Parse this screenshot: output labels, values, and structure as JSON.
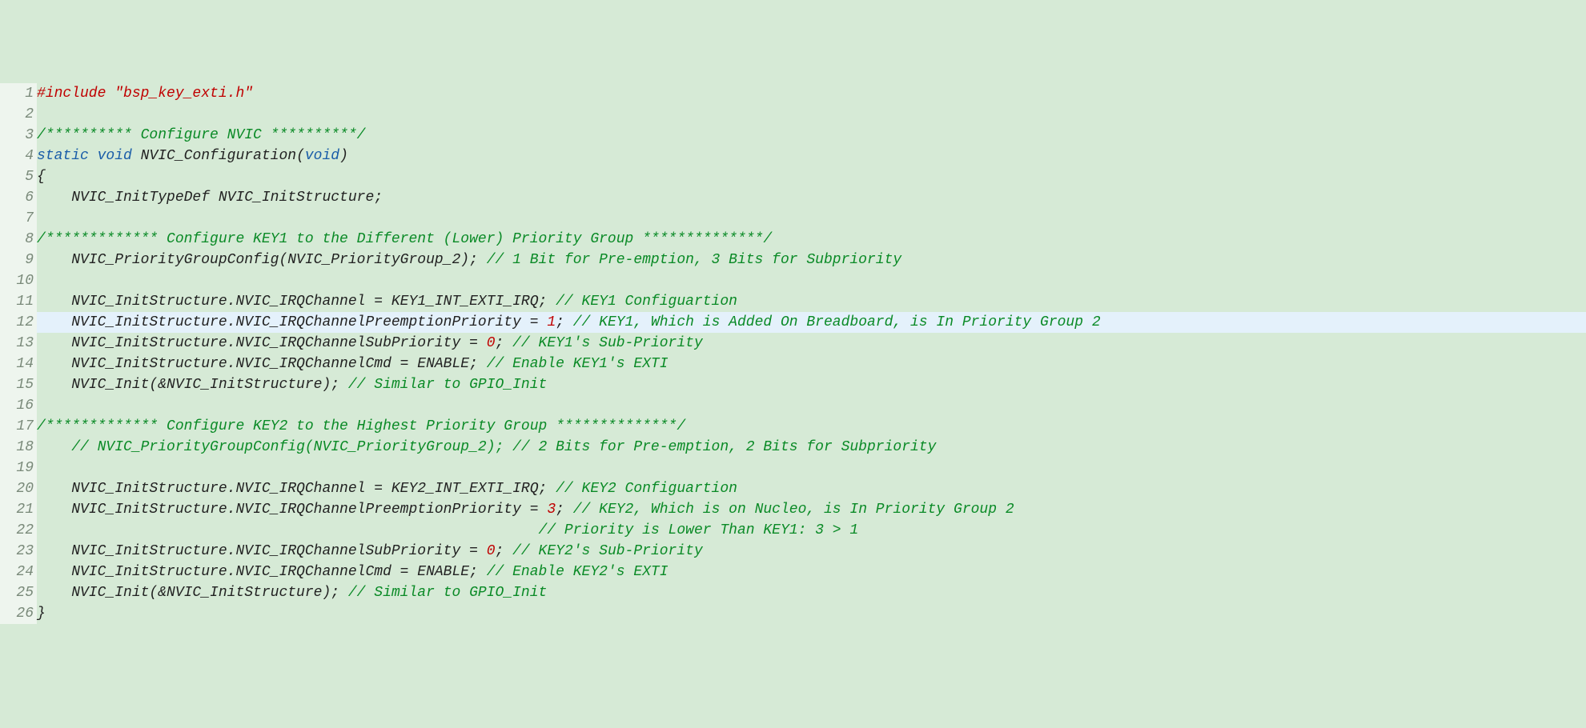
{
  "editor": {
    "highlighted_line": 12,
    "lines": {
      "1": {
        "tokens": [
          {
            "cls": "c-pre",
            "t": "#include "
          },
          {
            "cls": "c-str",
            "t": "\"bsp_key_exti.h\""
          }
        ]
      },
      "2": {
        "tokens": [
          {
            "cls": "c-id",
            "t": ""
          }
        ]
      },
      "3": {
        "tokens": [
          {
            "cls": "c-cmt",
            "t": "/********** Configure NVIC **********/"
          }
        ]
      },
      "4": {
        "tokens": [
          {
            "cls": "c-kw",
            "t": "static "
          },
          {
            "cls": "c-kw",
            "t": "void "
          },
          {
            "cls": "c-id",
            "t": "NVIC_Configuration("
          },
          {
            "cls": "c-kw",
            "t": "void"
          },
          {
            "cls": "c-id",
            "t": ")"
          }
        ]
      },
      "5": {
        "tokens": [
          {
            "cls": "c-id",
            "t": "{"
          }
        ]
      },
      "6": {
        "tokens": [
          {
            "cls": "c-id",
            "t": "    NVIC_InitTypeDef NVIC_InitStructure;"
          }
        ]
      },
      "7": {
        "tokens": [
          {
            "cls": "c-id",
            "t": ""
          }
        ]
      },
      "8": {
        "tokens": [
          {
            "cls": "c-cmt",
            "t": "/************* Configure KEY1 to the Different (Lower) Priority Group **************/"
          }
        ]
      },
      "9": {
        "tokens": [
          {
            "cls": "c-id",
            "t": "    NVIC_PriorityGroupConfig(NVIC_PriorityGroup_2); "
          },
          {
            "cls": "c-cmt",
            "t": "// 1 Bit for Pre-emption, 3 Bits for Subpriority"
          }
        ]
      },
      "10": {
        "tokens": [
          {
            "cls": "c-id",
            "t": ""
          }
        ]
      },
      "11": {
        "tokens": [
          {
            "cls": "c-id",
            "t": "    NVIC_InitStructure.NVIC_IRQChannel = KEY1_INT_EXTI_IRQ; "
          },
          {
            "cls": "c-cmt",
            "t": "// KEY1 Configuartion"
          }
        ]
      },
      "12": {
        "tokens": [
          {
            "cls": "c-id",
            "t": "    NVIC_InitStructure.NVIC_IRQChannelPreemptionPriority = "
          },
          {
            "cls": "c-num",
            "t": "1"
          },
          {
            "cls": "c-id",
            "t": "; "
          },
          {
            "cls": "c-cmt",
            "t": "// KEY1, Which is Added On Breadboard, is In Priority Group 2"
          }
        ]
      },
      "13": {
        "tokens": [
          {
            "cls": "c-id",
            "t": "    NVIC_InitStructure.NVIC_IRQChannelSubPriority = "
          },
          {
            "cls": "c-num",
            "t": "0"
          },
          {
            "cls": "c-id",
            "t": "; "
          },
          {
            "cls": "c-cmt",
            "t": "// KEY1's Sub-Priority"
          }
        ]
      },
      "14": {
        "tokens": [
          {
            "cls": "c-id",
            "t": "    NVIC_InitStructure.NVIC_IRQChannelCmd = ENABLE; "
          },
          {
            "cls": "c-cmt",
            "t": "// Enable KEY1's EXTI"
          }
        ]
      },
      "15": {
        "tokens": [
          {
            "cls": "c-id",
            "t": "    NVIC_Init(&NVIC_InitStructure); "
          },
          {
            "cls": "c-cmt",
            "t": "// Similar to GPIO_Init"
          }
        ]
      },
      "16": {
        "tokens": [
          {
            "cls": "c-id",
            "t": ""
          }
        ]
      },
      "17": {
        "tokens": [
          {
            "cls": "c-cmt",
            "t": "/************* Configure KEY2 to the Highest Priority Group **************/"
          }
        ]
      },
      "18": {
        "tokens": [
          {
            "cls": "c-id",
            "t": "    "
          },
          {
            "cls": "c-cmt",
            "t": "// NVIC_PriorityGroupConfig(NVIC_PriorityGroup_2); // 2 Bits for Pre-emption, 2 Bits for Subpriority"
          }
        ]
      },
      "19": {
        "tokens": [
          {
            "cls": "c-id",
            "t": ""
          }
        ]
      },
      "20": {
        "tokens": [
          {
            "cls": "c-id",
            "t": "    NVIC_InitStructure.NVIC_IRQChannel = KEY2_INT_EXTI_IRQ; "
          },
          {
            "cls": "c-cmt",
            "t": "// KEY2 Configuartion"
          }
        ]
      },
      "21": {
        "tokens": [
          {
            "cls": "c-id",
            "t": "    NVIC_InitStructure.NVIC_IRQChannelPreemptionPriority = "
          },
          {
            "cls": "c-num",
            "t": "3"
          },
          {
            "cls": "c-id",
            "t": "; "
          },
          {
            "cls": "c-cmt",
            "t": "// KEY2, Which is on Nucleo, is In Priority Group 2"
          }
        ]
      },
      "22": {
        "tokens": [
          {
            "cls": "c-id",
            "t": "                                                          "
          },
          {
            "cls": "c-cmt",
            "t": "// Priority is Lower Than KEY1: 3 > 1"
          }
        ]
      },
      "23": {
        "tokens": [
          {
            "cls": "c-id",
            "t": "    NVIC_InitStructure.NVIC_IRQChannelSubPriority = "
          },
          {
            "cls": "c-num",
            "t": "0"
          },
          {
            "cls": "c-id",
            "t": "; "
          },
          {
            "cls": "c-cmt",
            "t": "// KEY2's Sub-Priority"
          }
        ]
      },
      "24": {
        "tokens": [
          {
            "cls": "c-id",
            "t": "    NVIC_InitStructure.NVIC_IRQChannelCmd = ENABLE; "
          },
          {
            "cls": "c-cmt",
            "t": "// Enable KEY2's EXTI"
          }
        ]
      },
      "25": {
        "tokens": [
          {
            "cls": "c-id",
            "t": "    NVIC_Init(&NVIC_InitStructure); "
          },
          {
            "cls": "c-cmt",
            "t": "// Similar to GPIO_Init"
          }
        ]
      },
      "26": {
        "tokens": [
          {
            "cls": "c-id",
            "t": "}"
          }
        ]
      }
    }
  }
}
